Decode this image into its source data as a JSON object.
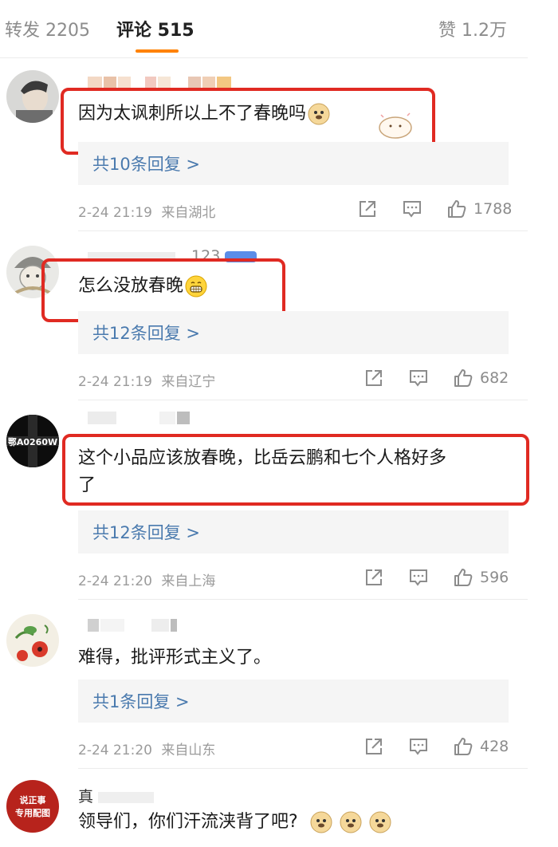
{
  "tabs": {
    "forward": "转发 2205",
    "comments": "评论 515",
    "likes": "赞 1.2万"
  },
  "comments": [
    {
      "text": "因为太讽刺所以上不了春晚吗",
      "reply_link": "共10条回复 >",
      "time": "2-24 21:19",
      "location": "来自湖北",
      "likes": "1788"
    },
    {
      "username_partial": "123",
      "text": "怎么没放春晚",
      "reply_link": "共12条回复 >",
      "time": "2-24 21:19",
      "location": "来自辽宁",
      "likes": "682"
    },
    {
      "avatar_text": "鄂A0260W",
      "text_line1": "这个小品应该放春晚，比岳云鹏和七个人格好多",
      "text_line2": "了",
      "reply_link": "共12条回复 >",
      "time": "2-24 21:20",
      "location": "来自上海",
      "likes": "596"
    },
    {
      "text": "难得，批评形式主义了。",
      "reply_link": "共1条回复 >",
      "time": "2-24 21:20",
      "location": "来自山东",
      "likes": "428"
    },
    {
      "avatar_line1": "说正事",
      "avatar_line2": "专用配图",
      "username_partial": "真",
      "text": "领导们，你们汗流浃背了吧?"
    }
  ],
  "colors": {
    "accent": "#ff8200",
    "highlight_box": "#e02a22",
    "reply_link": "#4a7aae"
  }
}
